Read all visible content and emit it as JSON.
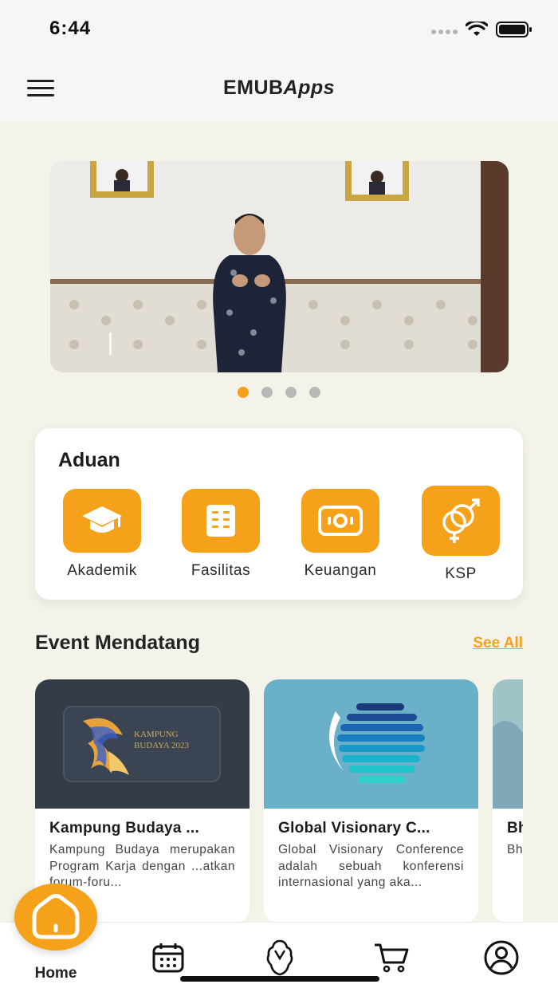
{
  "status_bar": {
    "time": "6:44"
  },
  "header": {
    "title_main": "EMUB",
    "title_italic": "Apps"
  },
  "carousel": {
    "active_index": 0,
    "slide_count": 4
  },
  "aduan": {
    "title": "Aduan",
    "items": [
      {
        "label": "Akademik",
        "icon": "graduation-cap-icon"
      },
      {
        "label": "Fasilitas",
        "icon": "building-icon"
      },
      {
        "label": "Keuangan",
        "icon": "money-icon"
      },
      {
        "label": "KSP",
        "icon": "gender-icon"
      }
    ]
  },
  "events_section": {
    "title": "Event Mendatang",
    "see_all": "See All"
  },
  "events": [
    {
      "title": "Kampung Budaya ...",
      "desc": "Kampung Budaya merupakan Program Karja dengan ...atkan forum-foru...",
      "image_text_1": "KAMPUNG",
      "image_text_2": "BUDAYA 2023"
    },
    {
      "title": "Global Visionary C...",
      "desc": "Global Visionary Conference adalah sebuah konferensi internasional yang aka..."
    },
    {
      "title": "Bh...",
      "desc": "Bh (Br Ba m..."
    }
  ],
  "bottom_nav": {
    "home_label": "Home"
  },
  "colors": {
    "accent": "#f5a21a",
    "background": "#f4f3ea"
  }
}
